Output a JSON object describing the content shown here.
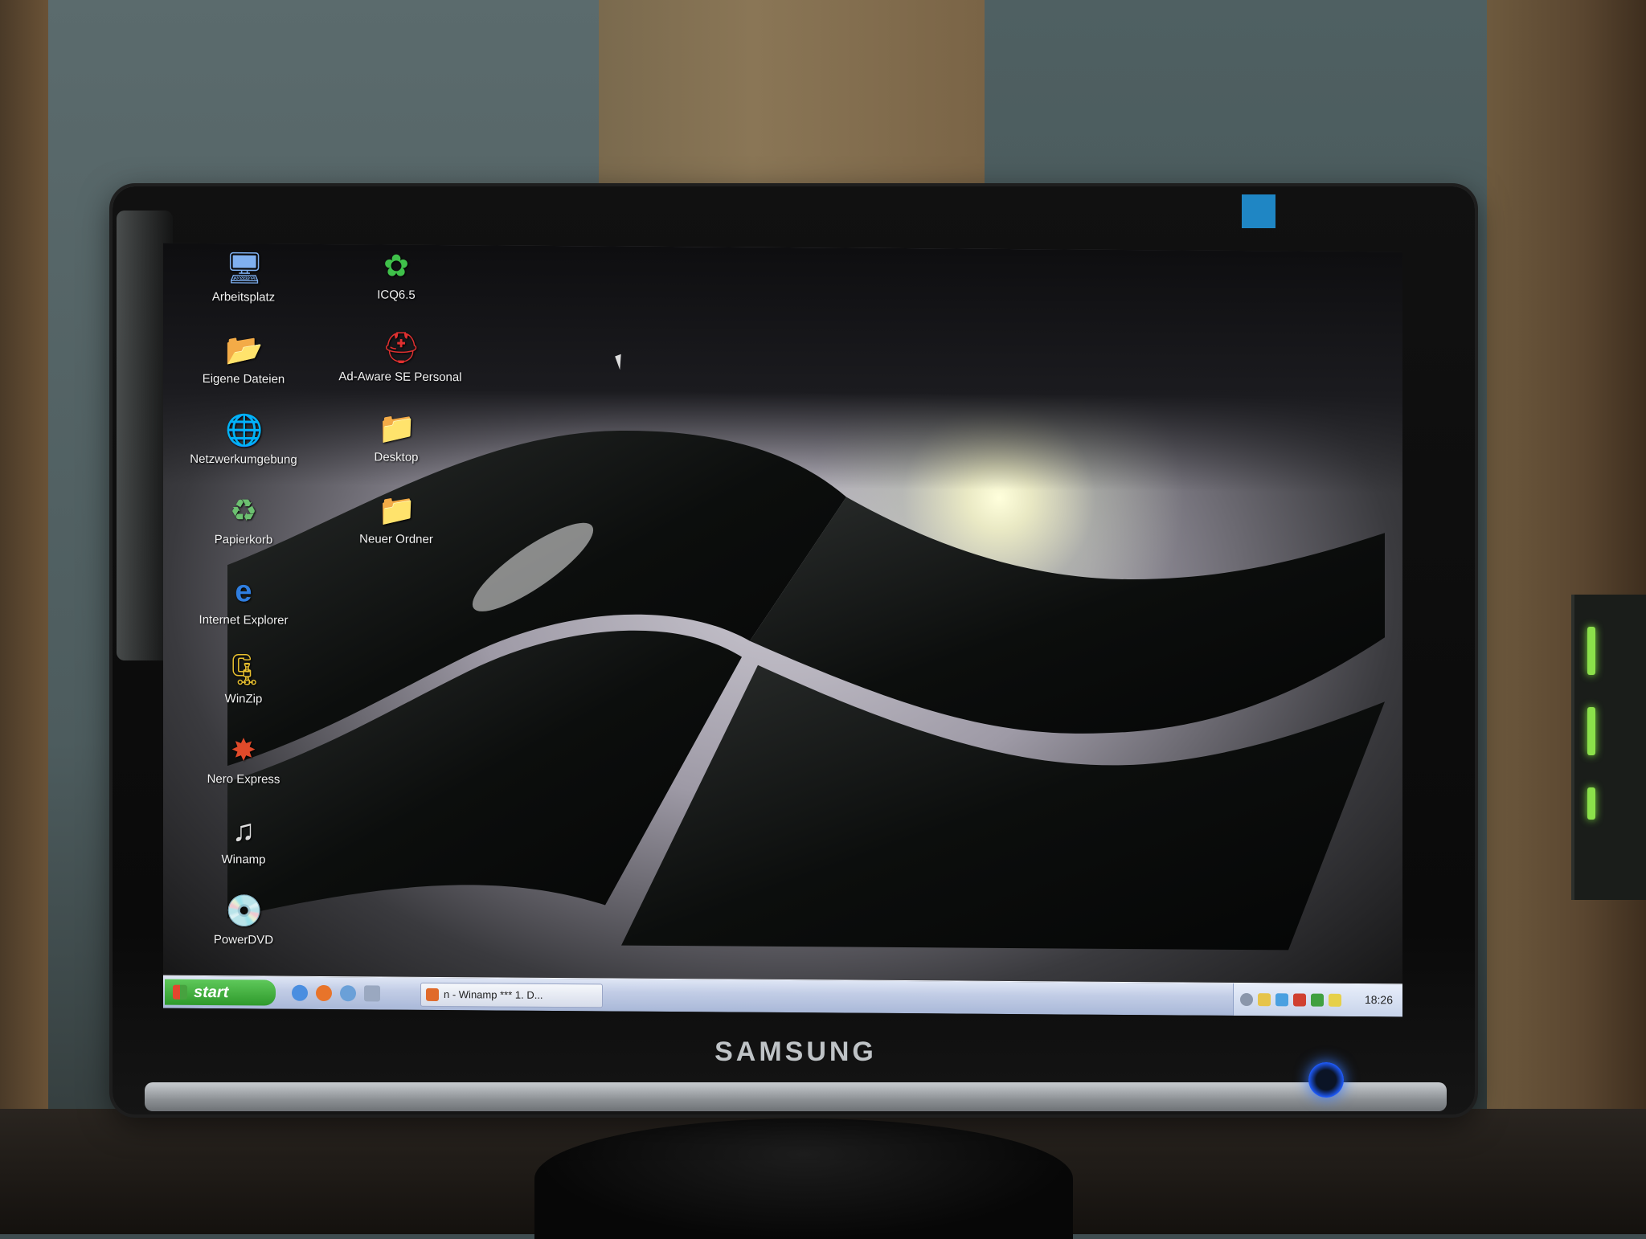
{
  "monitor": {
    "brand": "SAMSUNG"
  },
  "desktop": {
    "icons_left": [
      {
        "label": "Arbeitsplatz",
        "icon": "computer-icon"
      },
      {
        "label": "Eigene Dateien",
        "icon": "my-documents-icon"
      },
      {
        "label": "Netzwerkumgebung",
        "icon": "network-places-icon"
      },
      {
        "label": "Papierkorb",
        "icon": "recycle-bin-icon"
      },
      {
        "label": "Internet Explorer",
        "icon": "internet-explorer-icon"
      },
      {
        "label": "WinZip",
        "icon": "winzip-icon"
      },
      {
        "label": "Nero Express",
        "icon": "nero-express-icon"
      },
      {
        "label": "Winamp",
        "icon": "winamp-icon"
      },
      {
        "label": "PowerDVD",
        "icon": "powerdvd-icon"
      }
    ],
    "icons_right": [
      {
        "label": "ICQ6.5",
        "icon": "icq-flower-icon"
      },
      {
        "label": "Ad-Aware SE Personal",
        "icon": "ad-aware-icon"
      },
      {
        "label": "Desktop",
        "icon": "folder-icon"
      },
      {
        "label": "Neuer Ordner",
        "icon": "folder-icon"
      }
    ]
  },
  "taskbar": {
    "start_label": "start",
    "active_task": "n - Winamp *** 1. D...",
    "clock": "18:26",
    "colors": {
      "start_green": "#3fa83a",
      "bar_blue": "#c2cde6"
    }
  }
}
